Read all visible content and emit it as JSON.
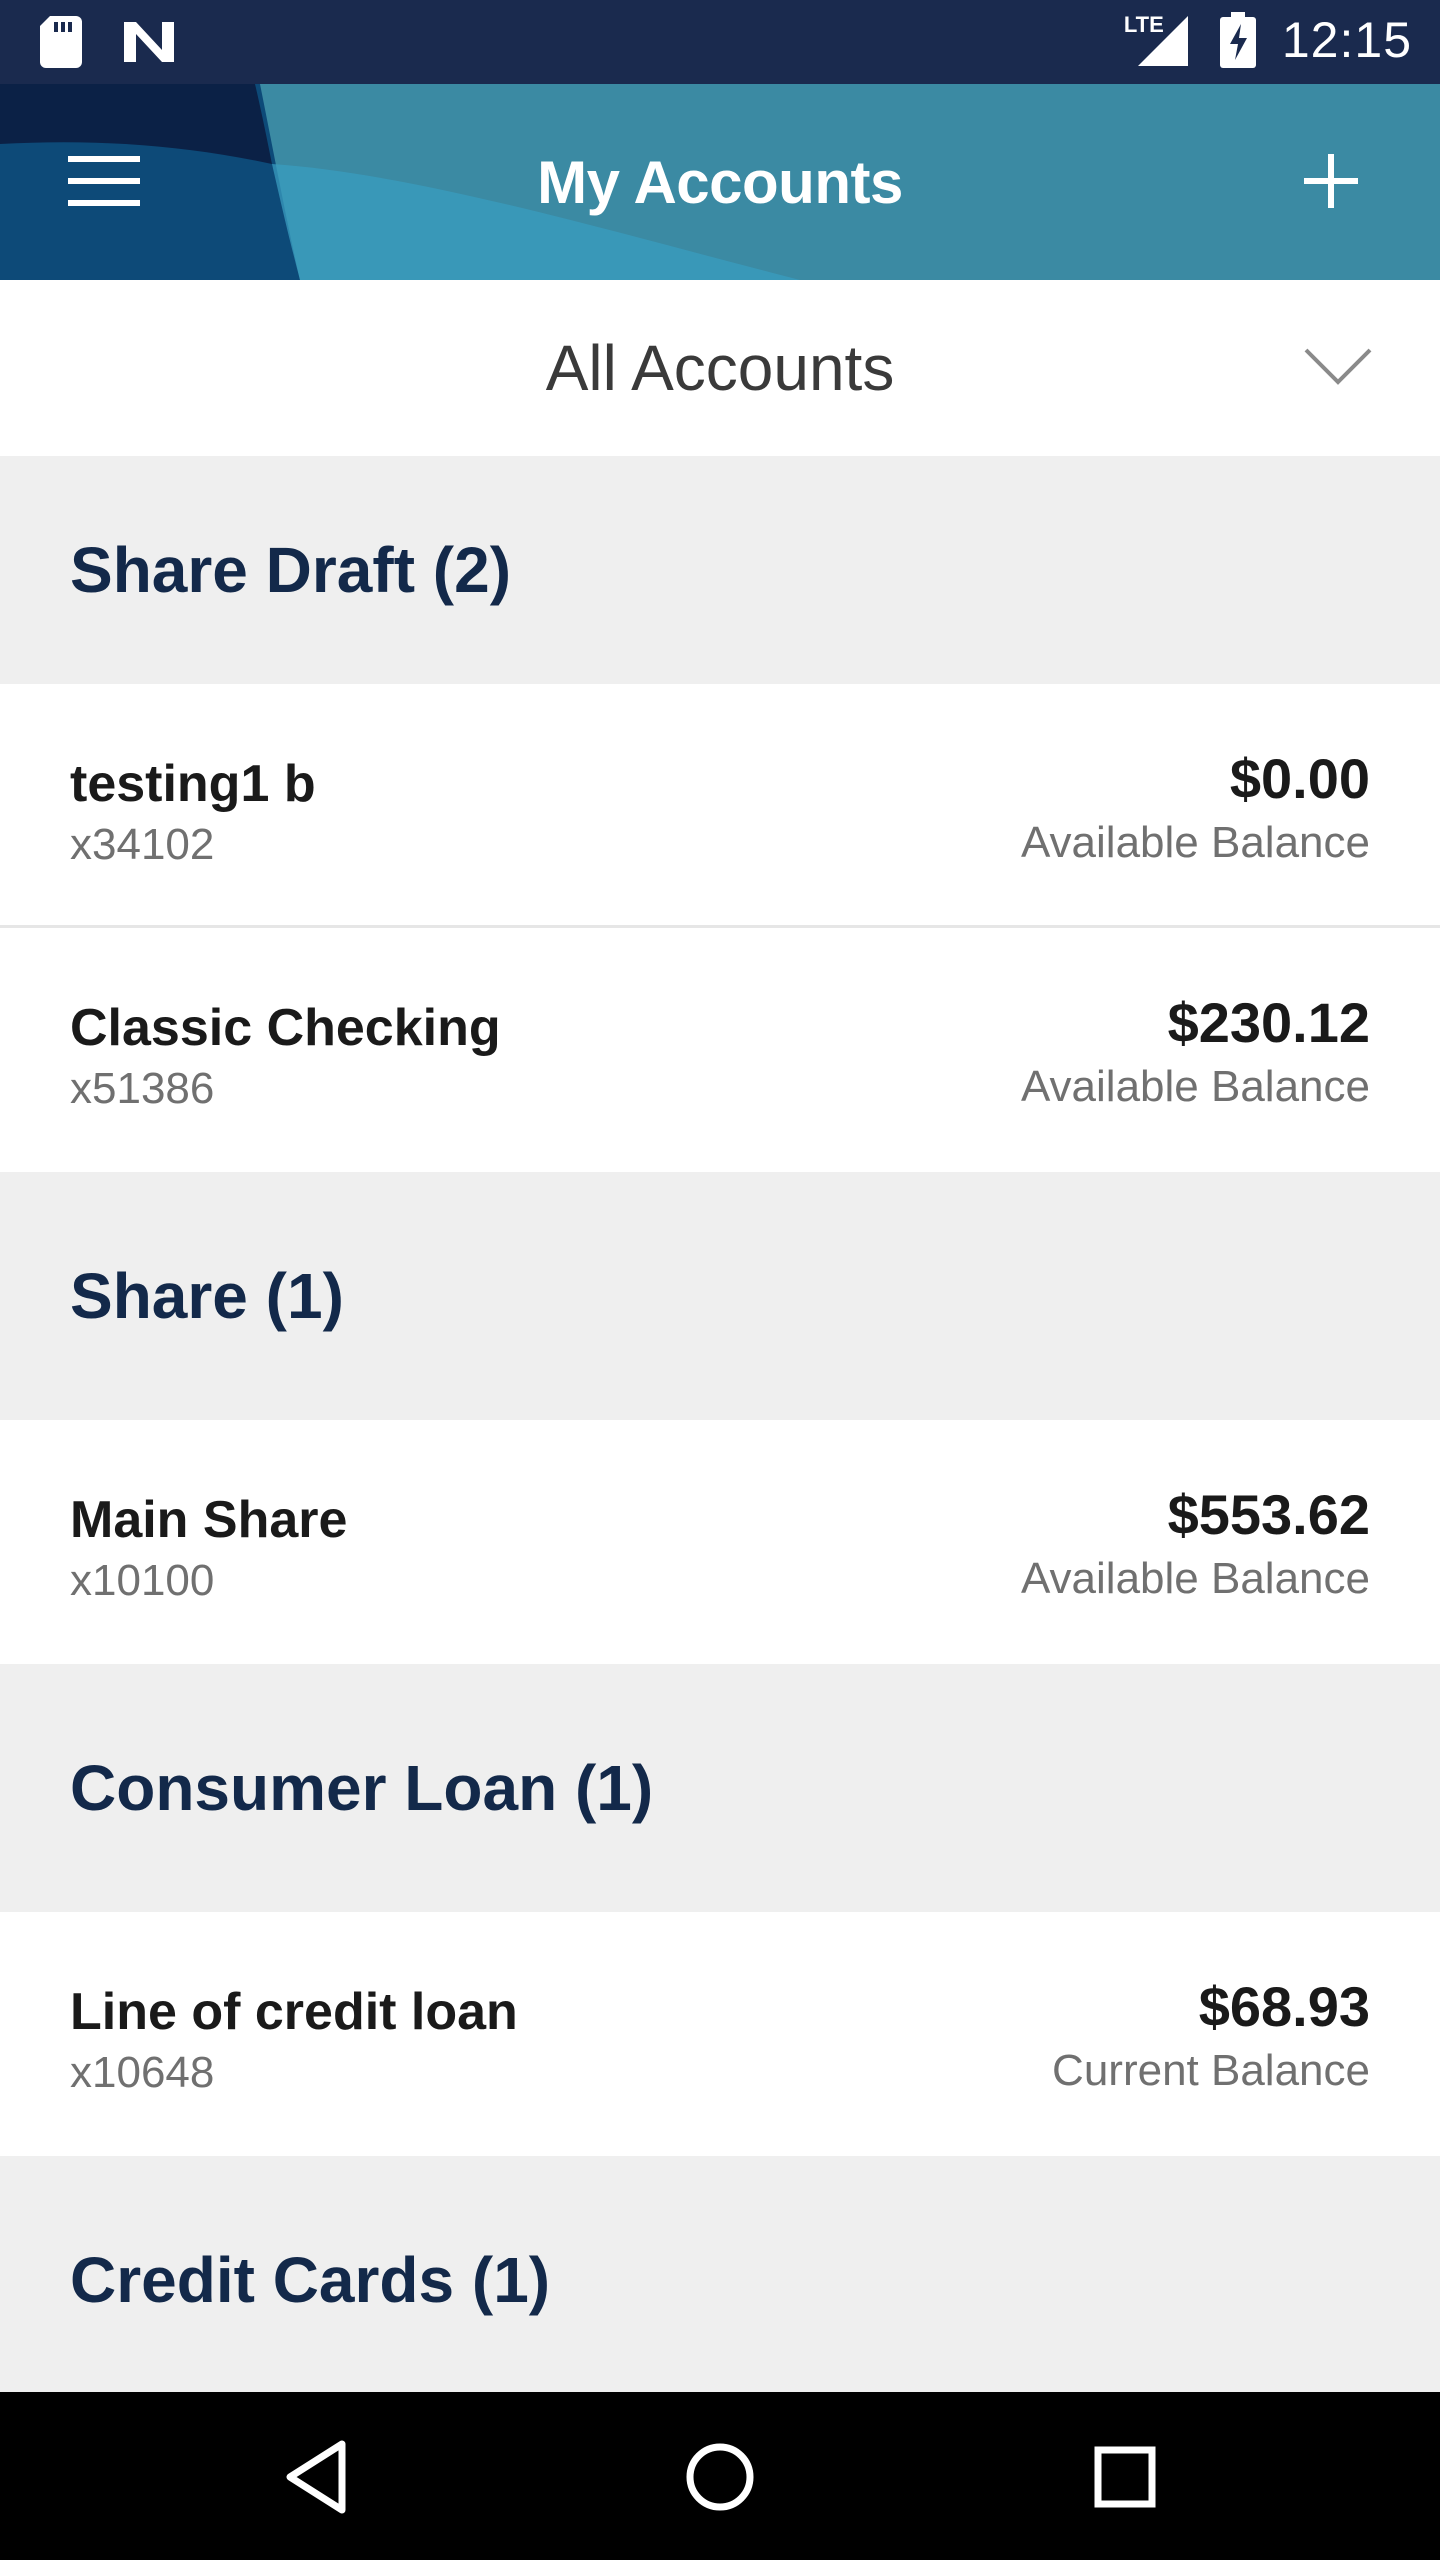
{
  "status_bar": {
    "time": "12:15",
    "network_label": "LTE",
    "icons": [
      "sd-card-icon",
      "n-logo-icon",
      "signal-icon",
      "battery-charging-icon"
    ]
  },
  "app_bar": {
    "title": "My Accounts",
    "menu_icon": "hamburger-menu-icon",
    "add_icon": "plus-icon"
  },
  "selector": {
    "label": "All Accounts",
    "icon": "chevron-down-icon"
  },
  "sections": [
    {
      "title": "Share Draft (2)",
      "accounts": [
        {
          "name": "testing1 b",
          "number": "x34102",
          "amount": "$0.00",
          "balance_label": "Available Balance"
        },
        {
          "name": "Classic Checking",
          "number": "x51386",
          "amount": "$230.12",
          "balance_label": "Available Balance"
        }
      ]
    },
    {
      "title": "Share (1)",
      "accounts": [
        {
          "name": "Main Share",
          "number": "x10100",
          "amount": "$553.62",
          "balance_label": "Available Balance"
        }
      ]
    },
    {
      "title": "Consumer Loan (1)",
      "accounts": [
        {
          "name": "Line of credit loan",
          "number": "x10648",
          "amount": "$68.93",
          "balance_label": "Current Balance"
        }
      ]
    },
    {
      "title": "Credit Cards (1)",
      "accounts": []
    }
  ],
  "nav_bar": {
    "icons": [
      "back-triangle-icon",
      "home-circle-icon",
      "recents-square-icon"
    ]
  },
  "colors": {
    "status_bar": "#1a2a4e",
    "app_bar": "#3d8aa2",
    "section_title": "#13294a",
    "section_bg": "#efefef"
  }
}
